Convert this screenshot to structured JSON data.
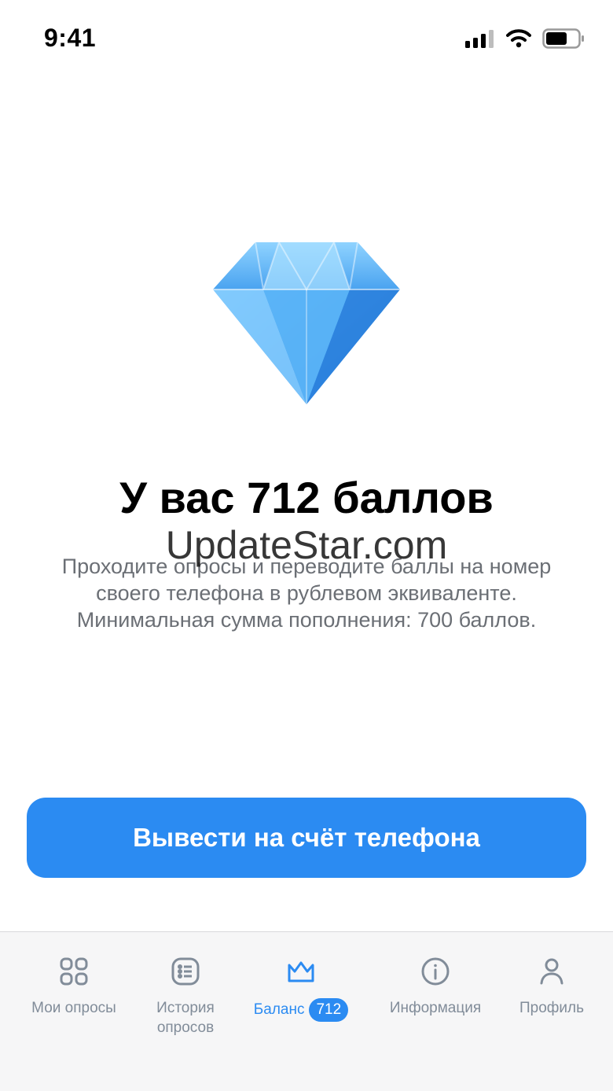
{
  "status_bar": {
    "time": "9:41"
  },
  "hero": {
    "icon": "diamond-icon",
    "title": "У вас 712 баллов",
    "watermark": "UpdateStar.com",
    "description": "Проходите опросы и переводите баллы на номер своего телефона в рублевом эквиваленте. Минимальная сумма пополнения: 700 баллов."
  },
  "actions": {
    "withdraw_label": "Вывести на счёт телефона"
  },
  "colors": {
    "accent": "#2b8bf2",
    "tab_inactive": "#818c99",
    "text_secondary": "#6b6f75"
  },
  "tab_bar": {
    "tabs": [
      {
        "label": "Мои опросы",
        "icon": "grid-icon"
      },
      {
        "label": "История опросов",
        "icon": "list-icon"
      },
      {
        "label": "Баланс",
        "icon": "crown-icon",
        "badge": "712",
        "active": true
      },
      {
        "label": "Информация",
        "icon": "info-icon"
      },
      {
        "label": "Профиль",
        "icon": "person-icon"
      }
    ]
  }
}
